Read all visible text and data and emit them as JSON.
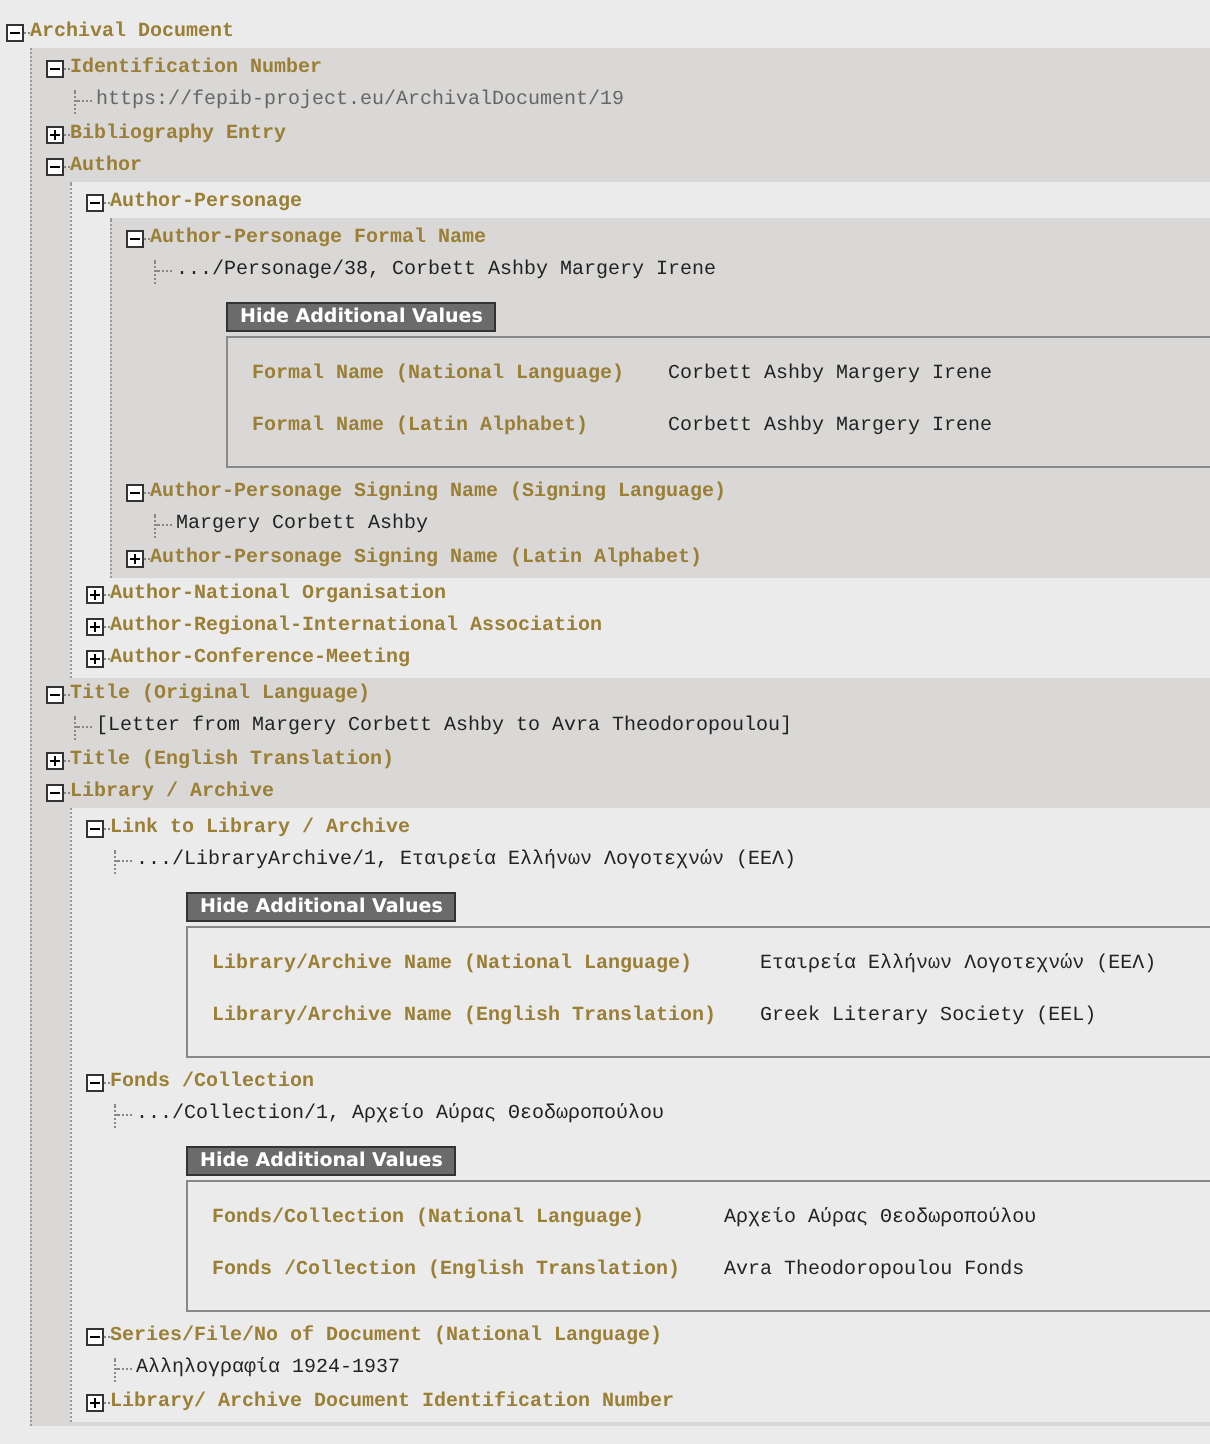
{
  "tree": [
    {
      "label": "Archival Document",
      "expanded": true,
      "children": [
        {
          "label": "Identification Number",
          "expanded": true,
          "value": {
            "kind": "uri",
            "text": "https://fepib-project.eu/ArchivalDocument/19"
          }
        },
        {
          "label": "Bibliography Entry",
          "expanded": false
        },
        {
          "label": "Author",
          "expanded": true,
          "children": [
            {
              "label": "Author-Personage",
              "expanded": true,
              "children": [
                {
                  "label": "Author-Personage Formal Name",
                  "expanded": true,
                  "value": {
                    "kind": "text",
                    "text": ".../Personage/38, Corbett Ashby Margery Irene"
                  },
                  "extra": {
                    "button": "Hide Additional Values",
                    "rows": [
                      {
                        "name": "Formal Name (National Language)",
                        "value": "Corbett Ashby Margery Irene"
                      },
                      {
                        "name": "Formal Name (Latin Alphabet)",
                        "value": "Corbett Ashby Margery Irene"
                      }
                    ]
                  }
                },
                {
                  "label": "Author-Personage Signing Name (Signing Language)",
                  "expanded": true,
                  "value": {
                    "kind": "text",
                    "text": "Margery Corbett Ashby"
                  }
                },
                {
                  "label": "Author-Personage Signing Name (Latin Alphabet)",
                  "expanded": false
                }
              ]
            },
            {
              "label": "Author-National Organisation",
              "expanded": false
            },
            {
              "label": "Author-Regional-International Association",
              "expanded": false
            },
            {
              "label": "Author-Conference-Meeting",
              "expanded": false
            }
          ]
        },
        {
          "label": "Title (Original Language)",
          "expanded": true,
          "value": {
            "kind": "text",
            "text": "[Letter from Margery Corbett Ashby to Avra Theodoropoulou]"
          }
        },
        {
          "label": "Title (English Translation)",
          "expanded": false
        },
        {
          "label": "Library / Archive",
          "expanded": true,
          "children": [
            {
              "label": "Link to Library / Archive",
              "expanded": true,
              "value": {
                "kind": "text",
                "text": ".../LibraryArchive/1, Εταιρεία Ελλήνων Λογοτεχνών (ΕΕΛ)"
              },
              "extra": {
                "button": "Hide Additional Values",
                "rows": [
                  {
                    "name": "Library/Archive Name (National Language)",
                    "value": "Εταιρεία Ελλήνων Λογοτεχνών (ΕΕΛ)"
                  },
                  {
                    "name": "Library/Archive Name (English Translation)",
                    "value": "Greek Literary Society (EEL)"
                  }
                ]
              }
            },
            {
              "label": "Fonds /Collection",
              "expanded": true,
              "value": {
                "kind": "text",
                "text": ".../Collection/1, Αρχείο Αύρας Θεοδωροπούλου"
              },
              "extra": {
                "button": "Hide Additional Values",
                "rows": [
                  {
                    "name": "Fonds/Collection (National Language)",
                    "value": "Αρχείο Αύρας Θεοδωροπούλου"
                  },
                  {
                    "name": "Fonds /Collection (English Translation)",
                    "value": "Avra Theodoropoulou Fonds"
                  }
                ]
              }
            },
            {
              "label": "Series/File/No of Document (National Language)",
              "expanded": true,
              "value": {
                "kind": "text",
                "text": "Αλληλογραφία 1924-1937"
              }
            },
            {
              "label": "Library/ Archive Document Identification Number",
              "expanded": false
            }
          ]
        }
      ]
    }
  ]
}
